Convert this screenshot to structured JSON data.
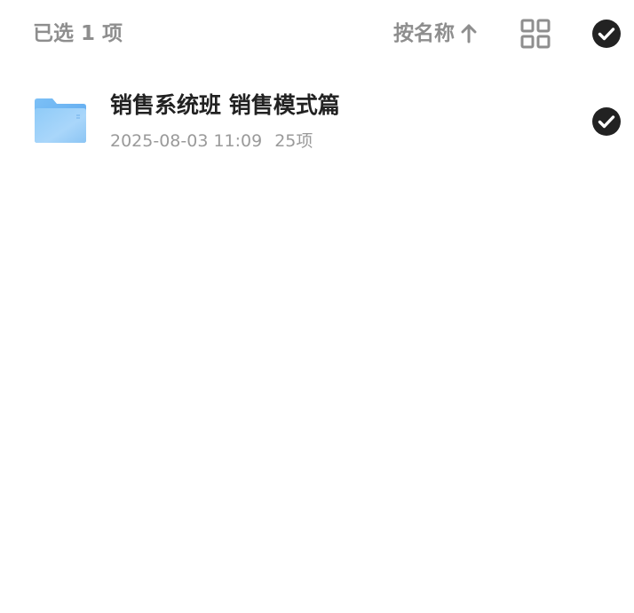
{
  "header": {
    "selected_label": "已选 1 项",
    "sort_label": "按名称",
    "sort_direction_icon": "arrow-up-icon",
    "view_toggle_icon": "grid-view-icon",
    "select_all_icon": "check-circle-icon",
    "select_all_checked": true
  },
  "items": [
    {
      "name": "销售系统班 销售模式篇",
      "date": "2025-08-03 11:09",
      "count": "25项",
      "icon": "folder-icon",
      "selected": true
    }
  ],
  "colors": {
    "header_text": "#8e8e8e",
    "title_text": "#222222",
    "meta_text": "#9a9a9a",
    "check_fill": "#222222",
    "folder_blue": "#6ab3f2"
  }
}
